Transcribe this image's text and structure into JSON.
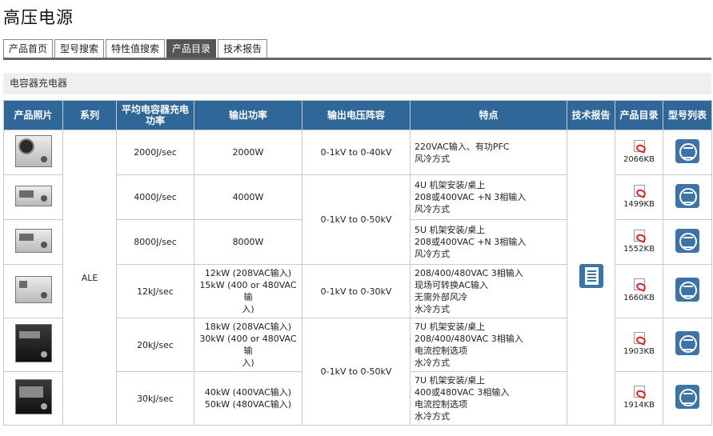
{
  "page": {
    "title": "高压电源"
  },
  "tabs": [
    {
      "label": "产品首页",
      "active": false
    },
    {
      "label": "型号搜索",
      "active": false
    },
    {
      "label": "特性值搜索",
      "active": false
    },
    {
      "label": "产品目录",
      "active": true
    },
    {
      "label": "技术报告",
      "active": false
    }
  ],
  "section": {
    "title": "电容器充电器"
  },
  "table": {
    "headers": {
      "photo": "产品照片",
      "series": "系列",
      "energy_rate": "平均电容器充电功率",
      "output_power": "输出功率",
      "voltage_range": "输出电压阵容",
      "features": "特点",
      "tech_report": "技术报告",
      "catalog": "产品目录",
      "model_list": "型号列表"
    },
    "series": "ALE",
    "rows": [
      {
        "rate": "2000J/sec",
        "power": [
          "2000W"
        ],
        "features": [
          "220VAC输入、有功PFC",
          "风冷方式"
        ],
        "pdf_size": "2066KB"
      },
      {
        "rate": "4000J/sec",
        "power": [
          "4000W"
        ],
        "features": [
          "4U 机架安装/桌上",
          "208或400VAC +N 3相输入",
          "风冷方式"
        ],
        "pdf_size": "1499KB"
      },
      {
        "rate": "8000J/sec",
        "power": [
          "8000W"
        ],
        "features": [
          "5U 机架安装/桌上",
          "208或400VAC +N 3相输入",
          "风冷方式"
        ],
        "pdf_size": "1552KB"
      },
      {
        "rate": "12kJ/sec",
        "power": [
          "12kW (208VAC输入)",
          "15kW (400 or 480VAC输",
          "入)"
        ],
        "features": [
          "208/400/480VAC 3相输入",
          "现场可转换AC输入",
          "无需外部风冷",
          "水冷方式"
        ],
        "pdf_size": "1660KB"
      },
      {
        "rate": "20kJ/sec",
        "power": [
          "18kW (208VAC输入)",
          "30kW (400 or 480VAC输",
          "入)"
        ],
        "features": [
          "7U 机架安装/桌上",
          "208/400/480VAC 3相输入",
          "电流控制选项",
          "水冷方式"
        ],
        "pdf_size": "1903KB"
      },
      {
        "rate": "30kJ/sec",
        "power": [
          "40kW (400VAC输入)",
          "50kW (480VAC输入)"
        ],
        "features": [
          "7U 机架安装/桌上",
          "400或480VAC 3相输入",
          "电流控制选项",
          "水冷方式"
        ],
        "pdf_size": "1914KB"
      }
    ],
    "voltage_groups": [
      {
        "label": "0-1kV to 0-40kV"
      },
      {
        "label": "0-1kV to 0-50kV"
      },
      {
        "label": "0-1kV to 0-30kV"
      },
      {
        "label": "0-1kV to 0-50kV"
      }
    ]
  },
  "colors": {
    "header_bg": "#2f6799",
    "active_tab": "#555555",
    "section_bg": "#efefef",
    "border": "#c9c9c9"
  }
}
